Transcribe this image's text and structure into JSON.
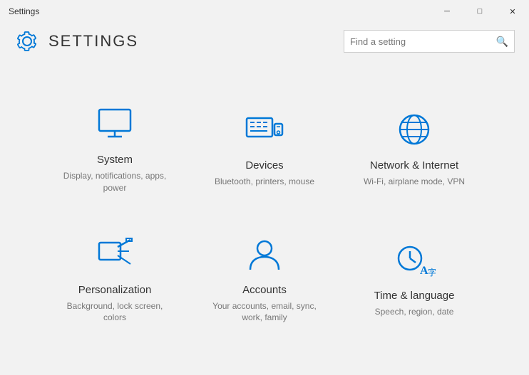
{
  "window": {
    "title": "Settings",
    "controls": {
      "minimize": "─",
      "maximize": "□",
      "close": "✕"
    }
  },
  "header": {
    "title": "SETTINGS",
    "search_placeholder": "Find a setting"
  },
  "settings_items": [
    {
      "id": "system",
      "title": "System",
      "description": "Display, notifications, apps, power",
      "icon": "system"
    },
    {
      "id": "devices",
      "title": "Devices",
      "description": "Bluetooth, printers, mouse",
      "icon": "devices"
    },
    {
      "id": "network",
      "title": "Network & Internet",
      "description": "Wi-Fi, airplane mode, VPN",
      "icon": "network"
    },
    {
      "id": "personalization",
      "title": "Personalization",
      "description": "Background, lock screen, colors",
      "icon": "personalization"
    },
    {
      "id": "accounts",
      "title": "Accounts",
      "description": "Your accounts, email, sync, work, family",
      "icon": "accounts"
    },
    {
      "id": "time",
      "title": "Time & language",
      "description": "Speech, region, date",
      "icon": "time"
    }
  ],
  "colors": {
    "accent": "#0078d7",
    "text_primary": "#333333",
    "text_secondary": "#777777",
    "background": "#f2f2f2"
  }
}
